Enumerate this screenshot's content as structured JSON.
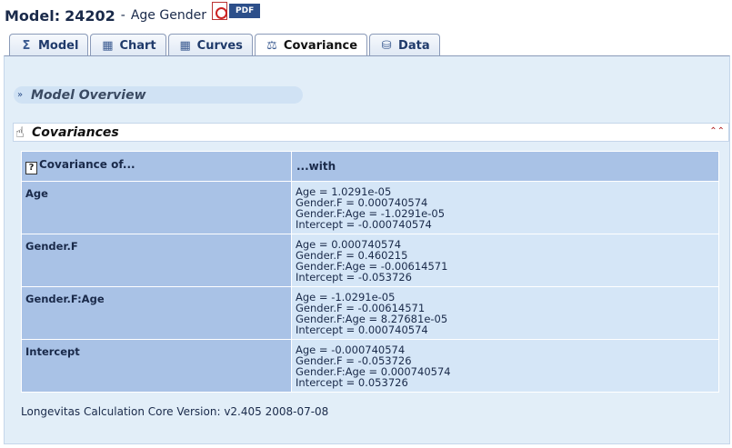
{
  "header": {
    "model_label": "Model:",
    "model_number": "24202",
    "separator": "-",
    "model_name": "Age Gender",
    "pdf_label": "PDF"
  },
  "tabs": [
    {
      "label": "Model",
      "icon": "sigma-icon",
      "glyph": "Σ",
      "active": false
    },
    {
      "label": "Chart",
      "icon": "bar-chart-icon",
      "glyph": "▦",
      "active": false
    },
    {
      "label": "Curves",
      "icon": "curves-icon",
      "glyph": "▦",
      "active": false
    },
    {
      "label": "Covariance",
      "icon": "balance-scale-icon",
      "glyph": "⚖",
      "active": true
    },
    {
      "label": "Data",
      "icon": "database-icon",
      "glyph": "⛁",
      "active": false
    }
  ],
  "sections": {
    "overview_title": "Model Overview",
    "covariances_title": "Covariances"
  },
  "table": {
    "header_col1": "Covariance of...",
    "header_col2": "...with",
    "rows": [
      {
        "name": "Age",
        "values": [
          "Age = 1.0291e-05",
          "Gender.F = 0.000740574",
          "Gender.F:Age = -1.0291e-05",
          "Intercept = -0.000740574"
        ]
      },
      {
        "name": "Gender.F",
        "values": [
          "Age = 0.000740574",
          "Gender.F = 0.460215",
          "Gender.F:Age = -0.00614571",
          "Intercept = -0.053726"
        ]
      },
      {
        "name": "Gender.F:Age",
        "values": [
          "Age = -1.0291e-05",
          "Gender.F = -0.00614571",
          "Gender.F:Age = 8.27681e-05",
          "Intercept = 0.000740574"
        ]
      },
      {
        "name": "Intercept",
        "values": [
          "Age = -0.000740574",
          "Gender.F = -0.053726",
          "Gender.F:Age = 0.000740574",
          "Intercept = 0.053726"
        ]
      }
    ]
  },
  "footer": {
    "text": "Longevitas Calculation Core Version: v2.405 2008-07-08"
  },
  "colors": {
    "header_cell": "#a9c2e6",
    "value_cell": "#d5e6f7",
    "panel_bg": "#e2eef8"
  }
}
